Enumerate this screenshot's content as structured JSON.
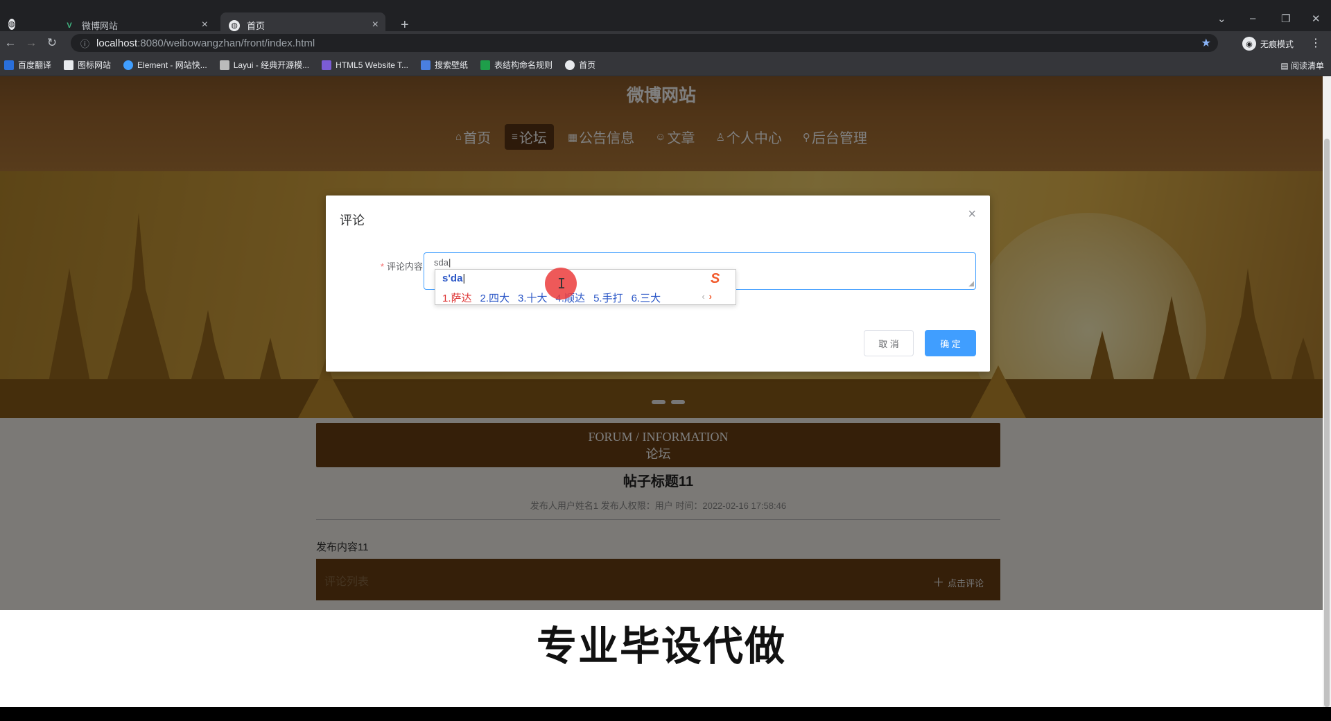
{
  "browser": {
    "tabs": [
      {
        "title": "微博网站"
      },
      {
        "title": "首页"
      }
    ],
    "url_host": "localhost",
    "url_path": ":8080/weibowangzhan/front/index.html",
    "profile_label": "无痕模式",
    "bookmarks": [
      "百度翻译",
      "图标网站",
      "Element - 网站快...",
      "Layui - 经典开源模...",
      "HTML5 Website T...",
      "搜索壁纸",
      "表结构命名规则",
      "首页"
    ],
    "reading_list": "阅读清单"
  },
  "site": {
    "title": "微博网站",
    "nav": [
      {
        "icon": "⌂",
        "label": "首页"
      },
      {
        "icon": "≡",
        "label": "论坛"
      },
      {
        "icon": "▦",
        "label": "公告信息"
      },
      {
        "icon": "☺",
        "label": "文章"
      },
      {
        "icon": "♙",
        "label": "个人中心"
      },
      {
        "icon": "⚲",
        "label": "后台管理"
      }
    ]
  },
  "forum": {
    "section_en": "FORUM / INFORMATION",
    "section_cn": "论坛",
    "post_title": "帖子标题11",
    "post_meta": "发布人用户姓名1   发布人权限：用户   时间：2022-02-16 17:58:46",
    "post_body": "发布内容11",
    "comments_label": "评论列表",
    "add_comment": "点击评论"
  },
  "dialog": {
    "title": "评论",
    "field_label": "评论内容",
    "field_value": "sda",
    "cancel": "取 消",
    "confirm": "确 定"
  },
  "ime": {
    "composition": "s'da",
    "candidates": [
      "1.萨达",
      "2.四大",
      "3.十大",
      "4.顺达",
      "5.手打",
      "6.三大"
    ]
  },
  "watermark": "专业毕设代做",
  "colors": {
    "accent": "#409eff",
    "header_brown": "#a0692f",
    "section_brown": "#6a3e13"
  }
}
